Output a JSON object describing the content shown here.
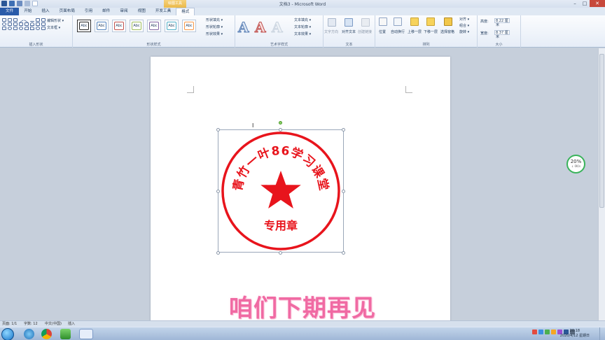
{
  "window": {
    "title": "文档3 - Microsoft Word",
    "context_tab_group": "绘图工具",
    "controls": [
      "–",
      "□",
      "✕"
    ]
  },
  "tabs": [
    {
      "label": "文件",
      "kind": "file"
    },
    {
      "label": "开始"
    },
    {
      "label": "插入"
    },
    {
      "label": "页面布局"
    },
    {
      "label": "引用"
    },
    {
      "label": "邮件"
    },
    {
      "label": "审阅"
    },
    {
      "label": "视图"
    },
    {
      "label": "开发工具"
    },
    {
      "label": "格式",
      "active": true
    }
  ],
  "ribbon": {
    "insert_shapes": {
      "label": "插入形状",
      "edit_shape": "编辑形状 ▾",
      "text_box": "文本框 ▾"
    },
    "shape_styles": {
      "label": "形状样式",
      "swatch_text": "Abc",
      "fill": "形状填充 ▾",
      "outline": "形状轮廓 ▾",
      "effects": "形状效果 ▾"
    },
    "wordart_styles": {
      "label": "艺术字样式",
      "text_fill": "文本填充 ▾",
      "text_outline": "文本轮廓 ▾",
      "text_effects": "文本效果 ▾"
    },
    "text": {
      "label": "文本",
      "direction": "文字方向",
      "align": "对齐文本",
      "link": "创建链接"
    },
    "arrange": {
      "label": "排列",
      "position": "位置",
      "wrap": "自动换行",
      "forward": "上移一层",
      "backward": "下移一层",
      "selection_pane": "选择窗格",
      "align": "对齐 ▾",
      "group": "组合 ▾",
      "rotate": "旋转 ▾"
    },
    "size": {
      "label": "大小",
      "height_label": "高度:",
      "height_value": "8.22 厘米",
      "width_label": "宽度:",
      "width_value": "8.37 厘米"
    }
  },
  "stamp": {
    "arc_text": "青竹一叶86学习课堂",
    "center_text": "专用章",
    "color": "#e8141c"
  },
  "overlay_caption": "咱们下期再见",
  "progress_widget": {
    "percent": "20%",
    "sub": "↓ 0K/s"
  },
  "status_bar": {
    "page": "页面: 1/1",
    "words": "字数: 12",
    "language": "中文(中国)",
    "mode": "插入"
  },
  "taskbar": {
    "time": "20:18",
    "date": "2020/4/12 星期日"
  }
}
